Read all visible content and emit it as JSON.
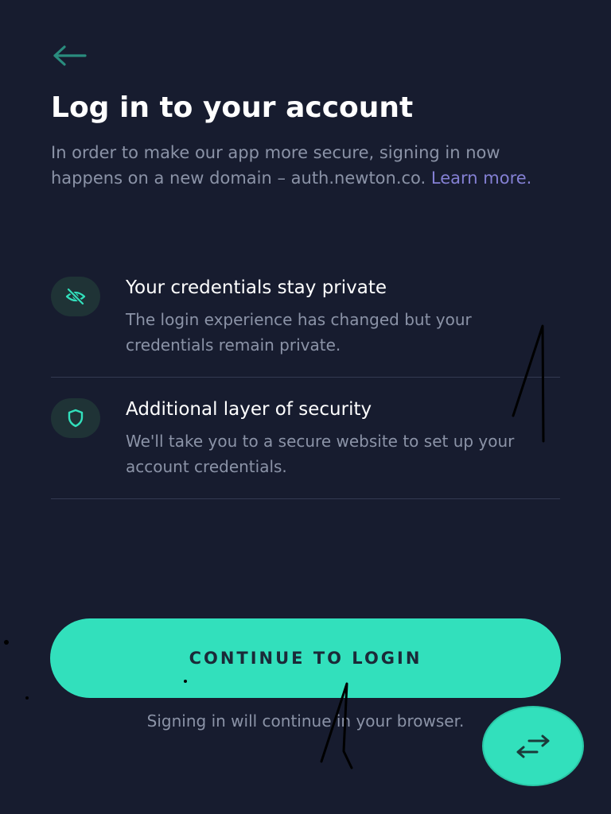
{
  "header": {
    "back_icon": "arrow-left-icon",
    "title": "Log in to your account"
  },
  "intro": {
    "text": "In order to make our app more secure, signing in now happens on a new domain – auth.newton.co. ",
    "learn_more_label": "Learn more."
  },
  "features": [
    {
      "icon": "eye-off-icon",
      "title": "Your credentials stay private",
      "description": "The login experience has changed but your credentials remain private."
    },
    {
      "icon": "shield-icon",
      "title": "Additional layer of security",
      "description": "We'll take you to a secure website to set up your account credentials."
    }
  ],
  "cta": {
    "label": "CONTINUE TO LOGIN"
  },
  "footnote": "Signing in will continue in your browser.",
  "fab": {
    "icon": "swap-arrows-icon"
  },
  "colors": {
    "background": "#171c2f",
    "accent": "#32e0bc",
    "link": "#8480d4",
    "muted_text": "#8b93a7",
    "divider": "#333a52"
  }
}
